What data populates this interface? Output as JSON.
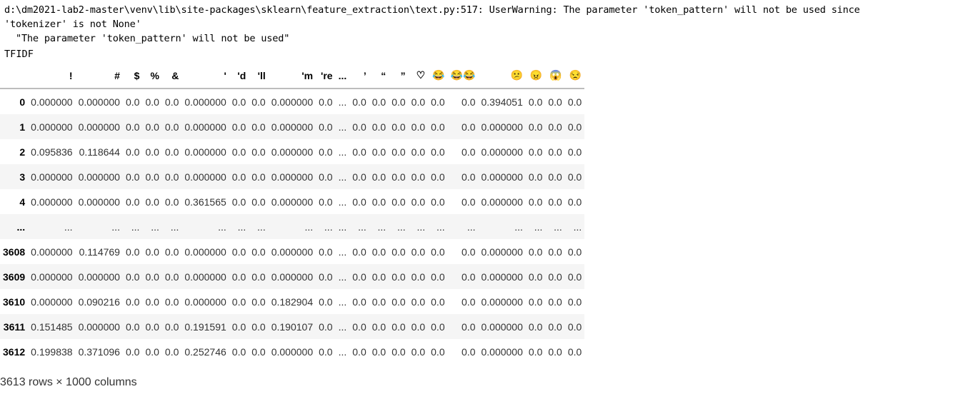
{
  "stderr_lines": [
    "d:\\dm2021-lab2-master\\venv\\lib\\site-packages\\sklearn\\feature_extraction\\text.py:517: UserWarning: The parameter 'token_pattern' will not be used since",
    "'tokenizer' is not None'",
    "  \"The parameter 'token_pattern' will not be used\""
  ],
  "stdout_text": "TFIDF",
  "table": {
    "columns": [
      "",
      "!",
      "#",
      "$",
      "%",
      "&",
      "'",
      "'d",
      "'ll",
      "'m",
      "'re",
      "...",
      "’",
      "“",
      "”",
      "♡",
      "😂",
      "😂😂",
      "😕",
      "😠",
      "😱",
      "😒"
    ],
    "rows": [
      [
        "0",
        "0.000000",
        "0.000000",
        "0.0",
        "0.0",
        "0.0",
        "0.000000",
        "0.0",
        "0.0",
        "0.000000",
        "0.0",
        "...",
        "0.0",
        "0.0",
        "0.0",
        "0.0",
        "0.0",
        "0.0",
        "0.394051",
        "0.0",
        "0.0",
        "0.0"
      ],
      [
        "1",
        "0.000000",
        "0.000000",
        "0.0",
        "0.0",
        "0.0",
        "0.000000",
        "0.0",
        "0.0",
        "0.000000",
        "0.0",
        "...",
        "0.0",
        "0.0",
        "0.0",
        "0.0",
        "0.0",
        "0.0",
        "0.000000",
        "0.0",
        "0.0",
        "0.0"
      ],
      [
        "2",
        "0.095836",
        "0.118644",
        "0.0",
        "0.0",
        "0.0",
        "0.000000",
        "0.0",
        "0.0",
        "0.000000",
        "0.0",
        "...",
        "0.0",
        "0.0",
        "0.0",
        "0.0",
        "0.0",
        "0.0",
        "0.000000",
        "0.0",
        "0.0",
        "0.0"
      ],
      [
        "3",
        "0.000000",
        "0.000000",
        "0.0",
        "0.0",
        "0.0",
        "0.000000",
        "0.0",
        "0.0",
        "0.000000",
        "0.0",
        "...",
        "0.0",
        "0.0",
        "0.0",
        "0.0",
        "0.0",
        "0.0",
        "0.000000",
        "0.0",
        "0.0",
        "0.0"
      ],
      [
        "4",
        "0.000000",
        "0.000000",
        "0.0",
        "0.0",
        "0.0",
        "0.361565",
        "0.0",
        "0.0",
        "0.000000",
        "0.0",
        "...",
        "0.0",
        "0.0",
        "0.0",
        "0.0",
        "0.0",
        "0.0",
        "0.000000",
        "0.0",
        "0.0",
        "0.0"
      ],
      [
        "...",
        "...",
        "...",
        "...",
        "...",
        "...",
        "...",
        "...",
        "...",
        "...",
        "...",
        "...",
        "...",
        "...",
        "...",
        "...",
        "...",
        "...",
        "...",
        "...",
        "...",
        "..."
      ],
      [
        "3608",
        "0.000000",
        "0.114769",
        "0.0",
        "0.0",
        "0.0",
        "0.000000",
        "0.0",
        "0.0",
        "0.000000",
        "0.0",
        "...",
        "0.0",
        "0.0",
        "0.0",
        "0.0",
        "0.0",
        "0.0",
        "0.000000",
        "0.0",
        "0.0",
        "0.0"
      ],
      [
        "3609",
        "0.000000",
        "0.000000",
        "0.0",
        "0.0",
        "0.0",
        "0.000000",
        "0.0",
        "0.0",
        "0.000000",
        "0.0",
        "...",
        "0.0",
        "0.0",
        "0.0",
        "0.0",
        "0.0",
        "0.0",
        "0.000000",
        "0.0",
        "0.0",
        "0.0"
      ],
      [
        "3610",
        "0.000000",
        "0.090216",
        "0.0",
        "0.0",
        "0.0",
        "0.000000",
        "0.0",
        "0.0",
        "0.182904",
        "0.0",
        "...",
        "0.0",
        "0.0",
        "0.0",
        "0.0",
        "0.0",
        "0.0",
        "0.000000",
        "0.0",
        "0.0",
        "0.0"
      ],
      [
        "3611",
        "0.151485",
        "0.000000",
        "0.0",
        "0.0",
        "0.0",
        "0.191591",
        "0.0",
        "0.0",
        "0.190107",
        "0.0",
        "...",
        "0.0",
        "0.0",
        "0.0",
        "0.0",
        "0.0",
        "0.0",
        "0.000000",
        "0.0",
        "0.0",
        "0.0"
      ],
      [
        "3612",
        "0.199838",
        "0.371096",
        "0.0",
        "0.0",
        "0.0",
        "0.252746",
        "0.0",
        "0.0",
        "0.000000",
        "0.0",
        "...",
        "0.0",
        "0.0",
        "0.0",
        "0.0",
        "0.0",
        "0.0",
        "0.000000",
        "0.0",
        "0.0",
        "0.0"
      ]
    ]
  },
  "footer_text": "3613 rows × 1000 columns"
}
